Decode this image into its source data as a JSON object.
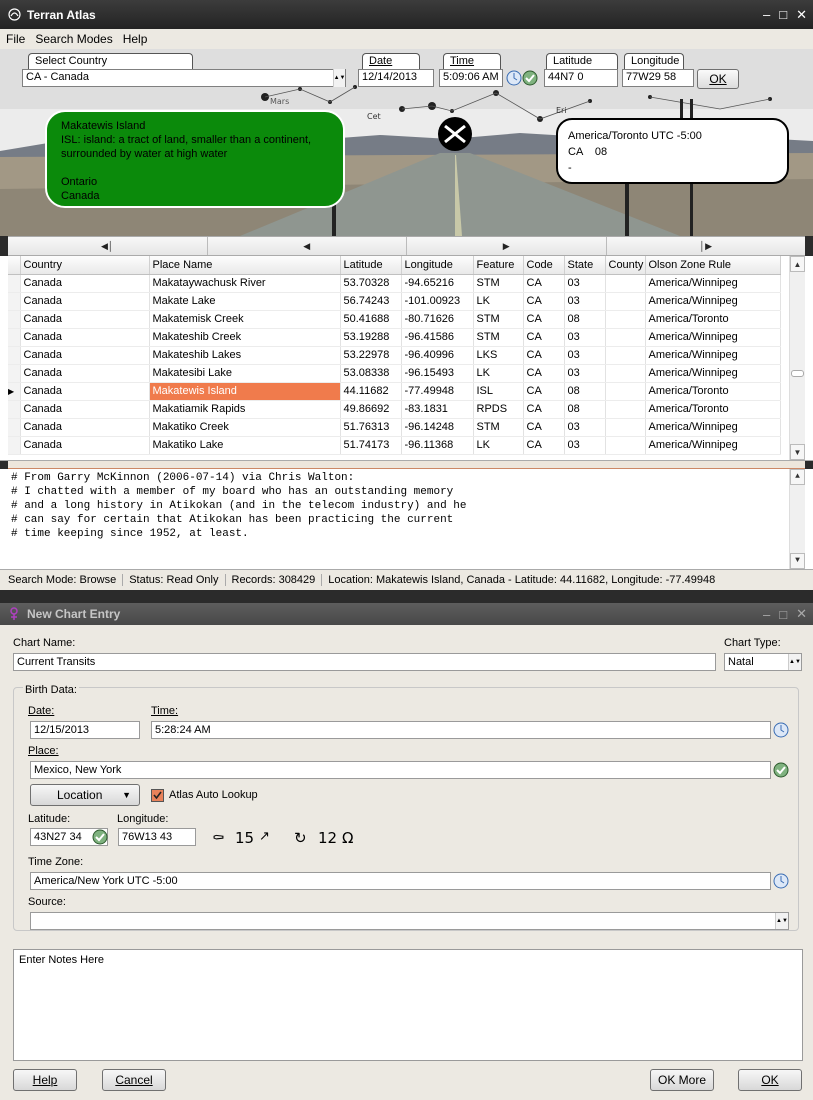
{
  "atlas": {
    "title": "Terran Atlas",
    "menu": [
      "File",
      "Search Modes",
      "Help"
    ],
    "fields": {
      "country_label": "Select Country",
      "country_value": "CA - Canada",
      "date_label": "Date",
      "date_value": "12/14/2013",
      "time_label": "Time",
      "time_value": "5:09:06 AM",
      "latitude_label": "Latitude",
      "latitude_value": "44N7 0",
      "longitude_label": "Longitude",
      "longitude_value": "77W29 58",
      "ok_label": "OK"
    },
    "place_box": {
      "name": "Makatewis Island",
      "desc": "ISL: island: a tract of land, smaller than a continent, surrounded by water at high water",
      "province": "Ontario",
      "country": "Canada"
    },
    "zone_box": {
      "zone": "America/Toronto UTC -5:00",
      "line2": "CA    08",
      "line3": "-"
    },
    "columns": [
      "Country",
      "Place Name",
      "Latitude",
      "Longitude",
      "Feature",
      "Code",
      "State",
      "County",
      "Olson Zone Rule"
    ],
    "rows": [
      [
        "Canada",
        "Makataywachusk River",
        "53.70328",
        "-94.65216",
        "STM",
        "CA",
        "03",
        "",
        "America/Winnipeg"
      ],
      [
        "Canada",
        "Makate Lake",
        "56.74243",
        "-101.00923",
        "LK",
        "CA",
        "03",
        "",
        "America/Winnipeg"
      ],
      [
        "Canada",
        "Makatemisk Creek",
        "50.41688",
        "-80.71626",
        "STM",
        "CA",
        "08",
        "",
        "America/Toronto"
      ],
      [
        "Canada",
        "Makateshib Creek",
        "53.19288",
        "-96.41586",
        "STM",
        "CA",
        "03",
        "",
        "America/Winnipeg"
      ],
      [
        "Canada",
        "Makateshib Lakes",
        "53.22978",
        "-96.40996",
        "LKS",
        "CA",
        "03",
        "",
        "America/Winnipeg"
      ],
      [
        "Canada",
        "Makatesibi Lake",
        "53.08338",
        "-96.15493",
        "LK",
        "CA",
        "03",
        "",
        "America/Winnipeg"
      ],
      [
        "Canada",
        "Makatewis Island",
        "44.11682",
        "-77.49948",
        "ISL",
        "CA",
        "08",
        "",
        "America/Toronto"
      ],
      [
        "Canada",
        "Makatiamik Rapids",
        "49.86692",
        "-83.1831",
        "RPDS",
        "CA",
        "08",
        "",
        "America/Toronto"
      ],
      [
        "Canada",
        "Makatiko Creek",
        "51.76313",
        "-96.14248",
        "STM",
        "CA",
        "03",
        "",
        "America/Winnipeg"
      ],
      [
        "Canada",
        "Makatiko Lake",
        "51.74173",
        "-96.11368",
        "LK",
        "CA",
        "03",
        "",
        "America/Winnipeg"
      ]
    ],
    "selected_row": 6,
    "notes_lines": [
      "# From Garry McKinnon (2006-07-14) via Chris Walton:",
      "# I chatted with a member of my board who has an outstanding memory",
      "# and a long history in Atikokan (and in the telecom industry) and he",
      "# can say for certain that Atikokan has been practicing the current",
      "# time keeping since 1952, at least."
    ],
    "status": {
      "mode": "Search Mode: Browse",
      "access": "Status: Read Only",
      "records": "Records: 308429",
      "location": "Location: Makatewis Island, Canada - Latitude: 44.11682, Longitude: -77.49948"
    }
  },
  "chart": {
    "title": "New Chart Entry",
    "chart_name_label": "Chart Name:",
    "chart_name_value": "Current Transits",
    "chart_type_label": "Chart Type:",
    "chart_type_value": "Natal",
    "birth_data_label": "Birth Data:",
    "date_label": "Date:",
    "date_value": "12/15/2013",
    "time_label": "Time:",
    "time_value": "5:28:24 AM",
    "place_label": "Place:",
    "place_value": "Mexico, New York",
    "location_button": "Location",
    "atlas_lookup_label": "Atlas Auto Lookup",
    "latitude_label": "Latitude:",
    "latitude_value": "43N27 34",
    "longitude_label": "Longitude:",
    "longitude_value": "76W13 43",
    "asc_value": "15",
    "mc_value": "12",
    "timezone_label": "Time Zone:",
    "timezone_value": "America/New York UTC -5:00",
    "source_label": "Source:",
    "source_value": "",
    "notes_value": "Enter Notes Here",
    "help_button": "Help",
    "cancel_button": "Cancel",
    "ok_more_button": "OK More",
    "ok_button": "OK"
  }
}
